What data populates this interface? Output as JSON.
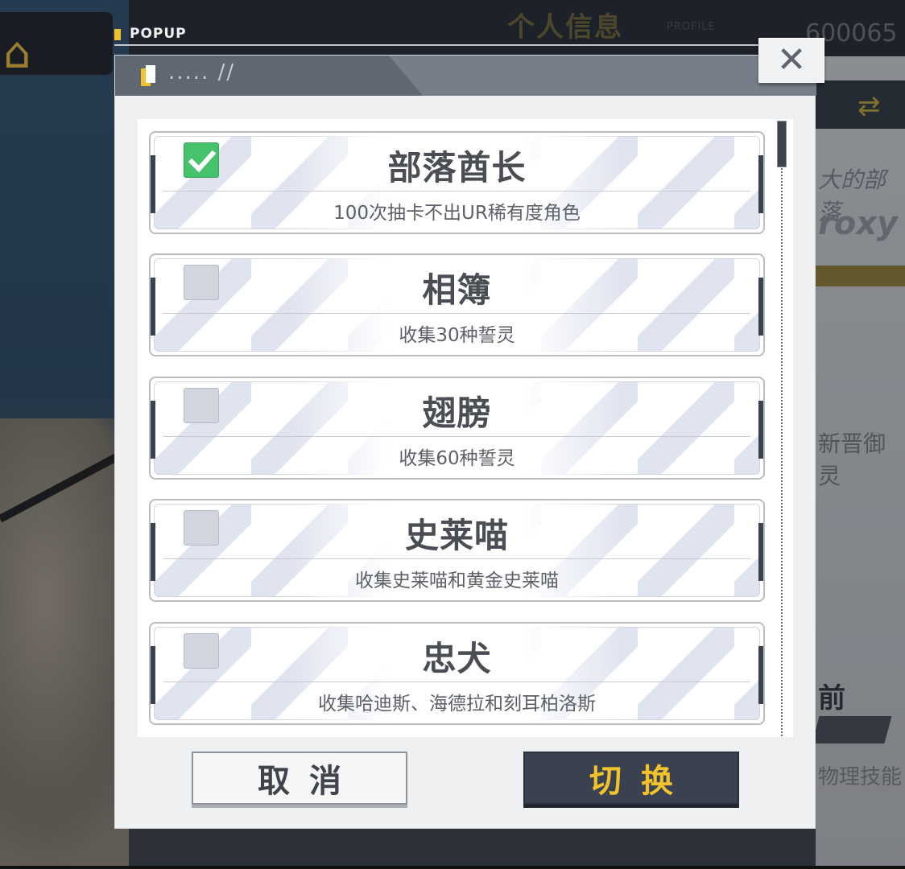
{
  "background": {
    "screen_title": "个人信息",
    "screen_title_sub": "PROFILE",
    "player_id": "600065",
    "right_text_1": "大的部落",
    "right_text_2": "roxy",
    "right_text_3": "新晋御灵",
    "right_text_4": "前",
    "right_text_5": "物理技能"
  },
  "popup": {
    "tag_label": "POPUP",
    "header_deco": "..... //",
    "close_label": "✕"
  },
  "titles": [
    {
      "name": "部落酋长",
      "desc": "100次抽卡不出UR稀有度角色",
      "checked": true
    },
    {
      "name": "相簿",
      "desc": "收集30种誓灵",
      "checked": false
    },
    {
      "name": "翅膀",
      "desc": "收集60种誓灵",
      "checked": false
    },
    {
      "name": "史莱喵",
      "desc": "收集史莱喵和黄金史莱喵",
      "checked": false
    },
    {
      "name": "忠犬",
      "desc": "收集哈迪斯、海德拉和刻耳柏洛斯",
      "checked": false
    }
  ],
  "buttons": {
    "cancel_label": "取消",
    "switch_label": "切换"
  },
  "colors": {
    "accent_yellow": "#f2c22c",
    "check_green": "#45c26b",
    "dark_button": "#3a4150"
  },
  "icons": {
    "home": "home-icon",
    "close": "close-icon",
    "check": "check-icon",
    "swap": "swap-icon"
  }
}
